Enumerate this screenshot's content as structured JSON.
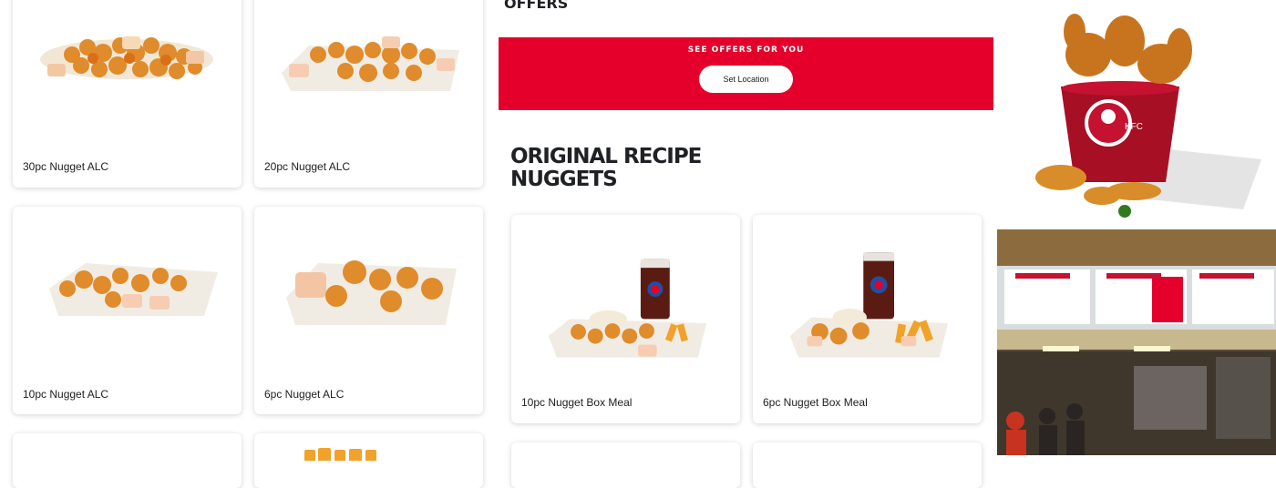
{
  "offers": {
    "heading": "OFFERS",
    "banner_title": "SEE OFFERS FOR YOU",
    "location_button": "Set Location"
  },
  "section": {
    "title_line1": "ORIGINAL RECIPE",
    "title_line2": "NUGGETS"
  },
  "left_products": [
    {
      "name": "30pc Nugget ALC"
    },
    {
      "name": "20pc Nugget ALC"
    },
    {
      "name": "10pc Nugget ALC"
    },
    {
      "name": "6pc Nugget ALC"
    }
  ],
  "meal_products": [
    {
      "name": "10pc Nugget Box Meal"
    },
    {
      "name": "6pc Nugget Box Meal"
    }
  ],
  "colors": {
    "brand_red": "#e4002b",
    "card_bg": "#ffffff"
  },
  "icons": {
    "bucket": "kfc-bucket-image",
    "restaurant": "restaurant-interior-image"
  }
}
